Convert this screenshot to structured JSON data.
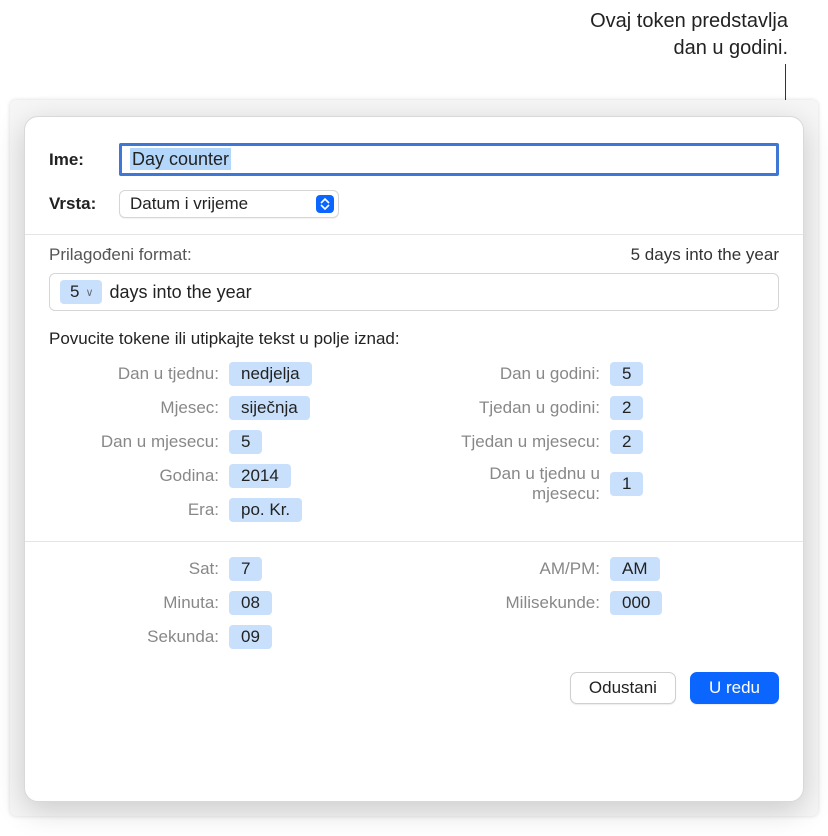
{
  "annotation": {
    "line1": "Ovaj token predstavlja",
    "line2": "dan u godini."
  },
  "labels": {
    "name": "Ime:",
    "type": "Vrsta:",
    "custom_format": "Prilagođeni format:",
    "drag_hint": "Povucite tokene ili utipkajte tekst u polje iznad:",
    "cancel": "Odustani",
    "ok": "U redu"
  },
  "name_value": "Day counter",
  "type_value": "Datum i vrijeme",
  "format_preview": "5 days into the year",
  "format_field": {
    "token_value": "5",
    "trailing_text": "days into the year"
  },
  "tokens": {
    "left1": [
      {
        "label": "Dan u tjednu:",
        "value": "nedjelja"
      },
      {
        "label": "Mjesec:",
        "value": "siječnja"
      },
      {
        "label": "Dan u mjesecu:",
        "value": "5"
      },
      {
        "label": "Godina:",
        "value": "2014"
      },
      {
        "label": "Era:",
        "value": "po. Kr."
      }
    ],
    "right1": [
      {
        "label": "Dan u godini:",
        "value": "5"
      },
      {
        "label": "Tjedan u godini:",
        "value": "2"
      },
      {
        "label": "Tjedan u mjesecu:",
        "value": "2"
      },
      {
        "label": "Dan u tjednu u mjesecu:",
        "value": "1"
      }
    ],
    "left2": [
      {
        "label": "Sat:",
        "value": "7"
      },
      {
        "label": "Minuta:",
        "value": "08"
      },
      {
        "label": "Sekunda:",
        "value": "09"
      }
    ],
    "right2": [
      {
        "label": "AM/PM:",
        "value": "AM"
      },
      {
        "label": "Milisekunde:",
        "value": "000"
      }
    ]
  }
}
